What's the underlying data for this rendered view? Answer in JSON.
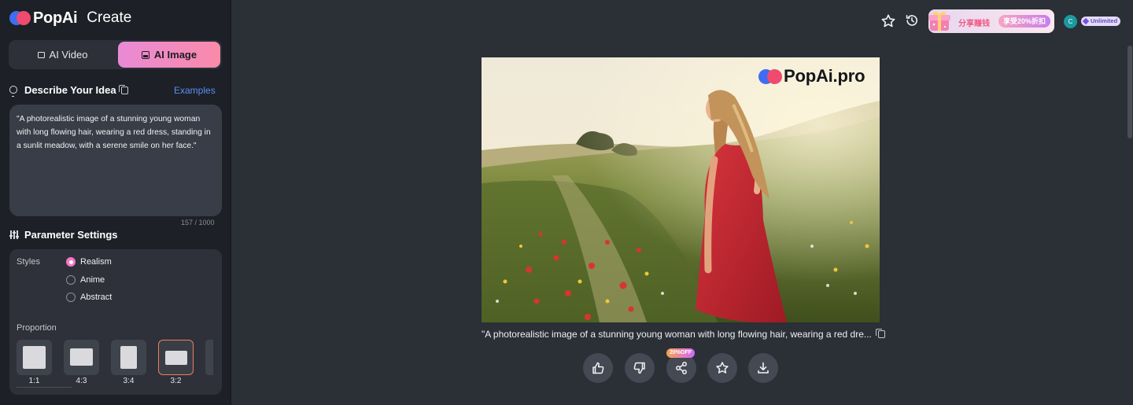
{
  "app": {
    "logo_text": "PopAi",
    "section": "Create"
  },
  "modes": [
    {
      "label": "AI Video",
      "active": false
    },
    {
      "label": "AI Image",
      "active": true
    }
  ],
  "idea": {
    "heading": "Describe Your Idea",
    "examples_link": "Examples",
    "prompt": "\"A photorealistic image of a stunning young woman with long flowing hair, wearing a red dress, standing in a sunlit meadow, with a serene smile on her face.\"",
    "char_count": "157 / 1000"
  },
  "params": {
    "heading": "Parameter Settings",
    "styles_label": "Styles",
    "styles": [
      {
        "label": "Realism",
        "selected": true
      },
      {
        "label": "Anime",
        "selected": false
      },
      {
        "label": "Abstract",
        "selected": false
      }
    ],
    "proportion_label": "Proportion",
    "ratios": [
      {
        "label": "1:1",
        "selected": false
      },
      {
        "label": "4:3",
        "selected": false
      },
      {
        "label": "3:4",
        "selected": false
      },
      {
        "label": "3:2",
        "selected": true
      }
    ]
  },
  "topbar": {
    "promo_text": "分享赚钱",
    "promo_pill": "享受20%折扣",
    "avatar_initial": "C",
    "plan_badge": "Unlimited"
  },
  "result": {
    "watermark": "PopAi.pro",
    "caption": "\"A photorealistic image of a stunning young woman with long flowing hair, wearing a red dre...",
    "share_badge": "20%OFF"
  },
  "icons": [
    "bulb-icon",
    "copy-icon",
    "sliders-icon",
    "star-icon",
    "history-icon",
    "gift-icon",
    "diamond-icon",
    "thumbs-up-icon",
    "thumbs-down-icon",
    "share-icon",
    "download-icon"
  ],
  "colors": {
    "accent_pink": "#f277c9",
    "link_blue": "#5b8ff7",
    "selected_ratio_border": "#e97f5d",
    "dress_red": "#c8252f"
  }
}
